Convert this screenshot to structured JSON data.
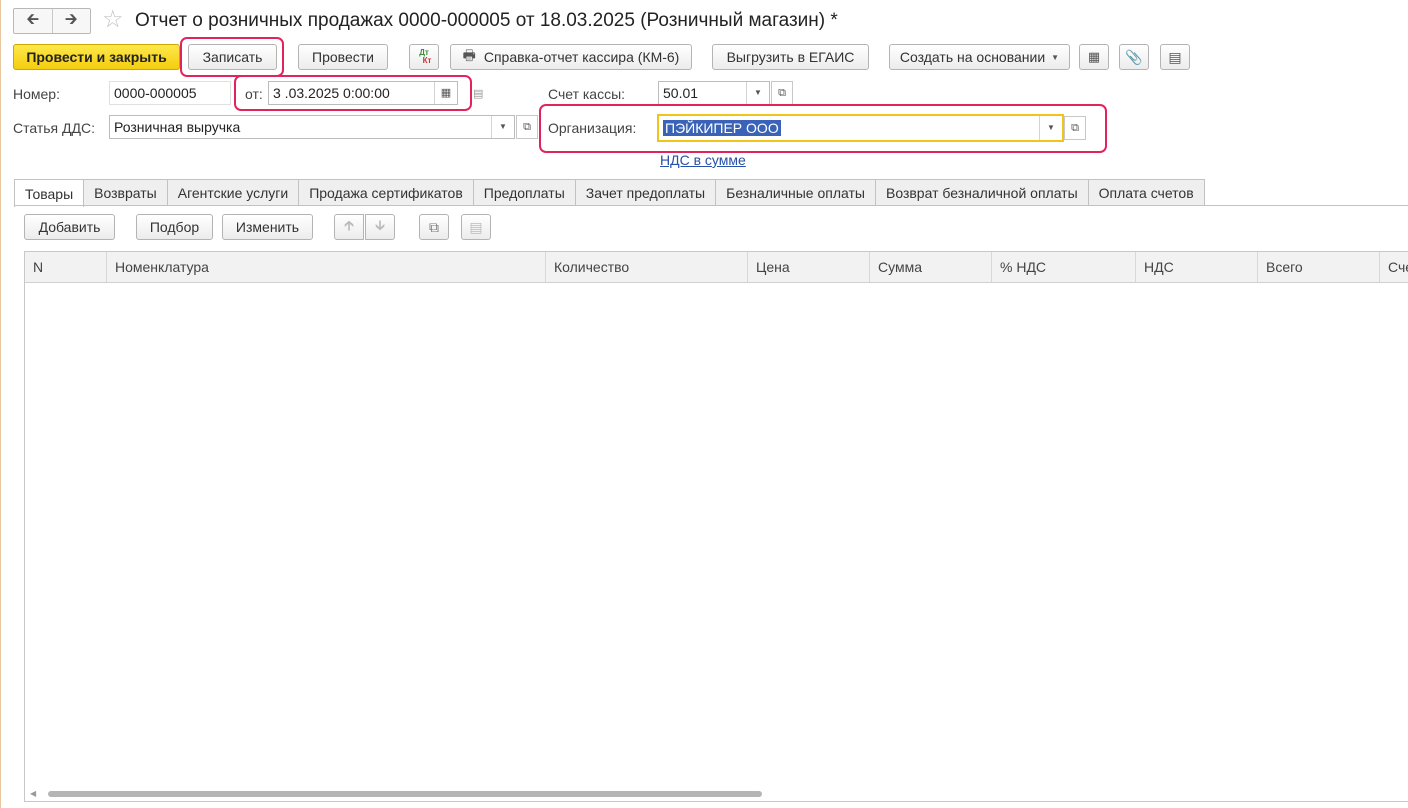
{
  "title": "Отчет о розничных продажах 0000-000005 от 18.03.2025 (Розничный магазин) *",
  "toolbar": {
    "post_close": "Провести и закрыть",
    "save": "Записать",
    "post": "Провести",
    "dtkt_top": "Дт",
    "dtkt_bottom": "Кт",
    "cashier_report": "Справка-отчет кассира (КМ-6)",
    "egais": "Выгрузить в ЕГАИС",
    "create_based": "Создать на основании"
  },
  "form": {
    "number_label": "Номер:",
    "number_value": "0000-000005",
    "date_label": "от:",
    "date_value": "3 .03.2025  0:00:00",
    "cash_account_label": "Счет кассы:",
    "cash_account_value": "50.01",
    "dds_label": "Статья ДДС:",
    "dds_value": "Розничная выручка",
    "org_label": "Организация:",
    "org_value": "ПЭЙКИПЕР ООО",
    "vat_link": "НДС в сумме"
  },
  "tabs": [
    "Товары",
    "Возвраты",
    "Агентские услуги",
    "Продажа сертификатов",
    "Предоплаты",
    "Зачет предоплаты",
    "Безналичные оплаты",
    "Возврат безналичной оплаты",
    "Оплата счетов"
  ],
  "table_toolbar": {
    "add": "Добавить",
    "pick": "Подбор",
    "edit": "Изменить"
  },
  "columns": [
    "N",
    "Номенклатура",
    "Количество",
    "Цена",
    "Сумма",
    "% НДС",
    "НДС",
    "Всего",
    "Сче"
  ],
  "colors": {
    "primary_button": "#f4cd0e",
    "highlight": "#e0245e",
    "focus_border": "#f0c419",
    "selection": "#3a63b8",
    "link": "#2750a8"
  }
}
